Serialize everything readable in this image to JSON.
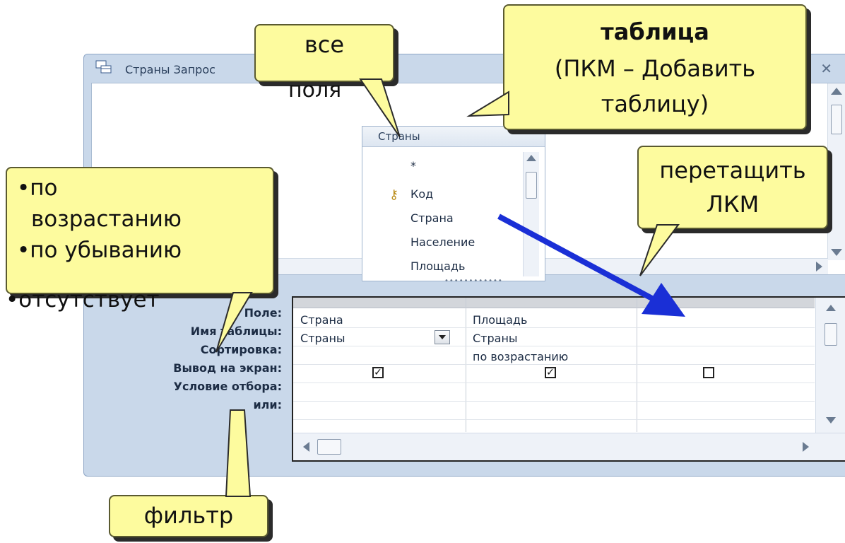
{
  "window": {
    "title": "Страны Запрос",
    "icon": "query-window-icon"
  },
  "field_list": {
    "title": "Страны",
    "items": [
      "*",
      "Код",
      "Страна",
      "Население",
      "Площадь"
    ],
    "key_icon": "primary-key-icon"
  },
  "grid": {
    "row_labels": [
      "Поле:",
      "Имя таблицы:",
      "Сортировка:",
      "Вывод на экран:",
      "Условие отбора:",
      "или:"
    ],
    "columns": [
      {
        "field": "Страна",
        "table": "Страны",
        "sort": "",
        "show": true
      },
      {
        "field": "Площадь",
        "table": "Страны",
        "sort": "по возрастанию",
        "show": true
      },
      {
        "field": "",
        "table": "",
        "sort": "",
        "show": false
      }
    ],
    "check_mark": "✓"
  },
  "callouts": {
    "all_fields": {
      "line1": "все",
      "line2": "поля"
    },
    "table": {
      "line1": "таблица",
      "line2": "(ПКМ – Добавить",
      "line3": "таблицу)"
    },
    "drag": {
      "line1": "перетащить",
      "line2": "ЛКМ"
    },
    "sort": {
      "line1": "•по",
      "line2": "возрастанию",
      "line3": "•по убыванию",
      "line4": "•отсутствует"
    },
    "filter": {
      "line1": "фильтр"
    }
  },
  "colors": {
    "callout_fill": "#fdfb9e",
    "arrow": "#1a2fd6",
    "window_frame": "#c9d8ea"
  }
}
